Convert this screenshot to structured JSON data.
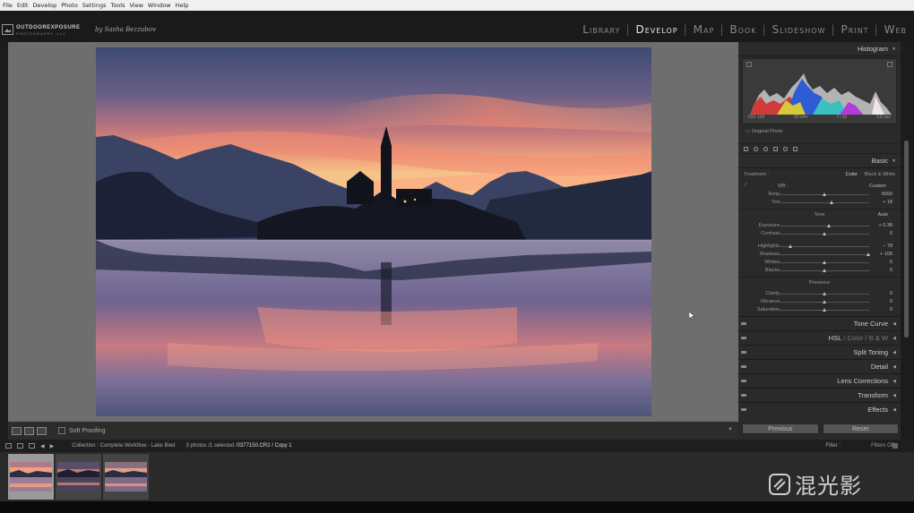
{
  "menu": [
    "File",
    "Edit",
    "Develop",
    "Photo",
    "Settings",
    "Tools",
    "View",
    "Window",
    "Help"
  ],
  "identity": {
    "brand": "OUTDOOREXPOSURE",
    "brand_line2": "PHOTOGRAPHY, LLC",
    "signature": "by Sasha Bezzubov"
  },
  "modules": [
    {
      "label": "Library",
      "active": false
    },
    {
      "label": "Develop",
      "active": true
    },
    {
      "label": "Map",
      "active": false
    },
    {
      "label": "Book",
      "active": false
    },
    {
      "label": "Slideshow",
      "active": false
    },
    {
      "label": "Print",
      "active": false
    },
    {
      "label": "Web",
      "active": false
    }
  ],
  "toolbar": {
    "soft_proofing": "Soft Proofing"
  },
  "histogram": {
    "title": "Histogram",
    "iso": "ISO 100",
    "focal": "50 mm",
    "aperture": "f / 10",
    "shutter": "0.8 sec",
    "original_photo": "Original Photo"
  },
  "basic": {
    "title": "Basic",
    "treatment_label": "Treatment :",
    "treatment_color": "Color",
    "treatment_bw": "Black & White",
    "wb_label": "WB :",
    "wb_value": "Custom",
    "tone_label": "Tone",
    "auto_label": "Auto",
    "presence_label": "Presence",
    "wb_sliders": [
      {
        "name": "Temp",
        "value": "6650",
        "pos": 0.5
      },
      {
        "name": "Tint",
        "value": "+ 18",
        "pos": 0.58
      }
    ],
    "tone_sliders": [
      {
        "name": "Exposure",
        "value": "+ 0.38",
        "pos": 0.55
      },
      {
        "name": "Contrast",
        "value": "0",
        "pos": 0.5
      }
    ],
    "tone_sliders_2": [
      {
        "name": "Highlights",
        "value": "− 78",
        "pos": 0.12
      },
      {
        "name": "Shadows",
        "value": "+ 100",
        "pos": 0.99
      },
      {
        "name": "Whites",
        "value": "0",
        "pos": 0.5
      },
      {
        "name": "Blacks",
        "value": "0",
        "pos": 0.5
      }
    ],
    "presence_sliders": [
      {
        "name": "Clarity",
        "value": "0",
        "pos": 0.5
      },
      {
        "name": "Vibrance",
        "value": "0",
        "pos": 0.5
      },
      {
        "name": "Saturation",
        "value": "0",
        "pos": 0.5
      }
    ]
  },
  "panels": {
    "tone_curve": "Tone Curve",
    "hsl": "HSL",
    "hsl_color": "Color",
    "hsl_bw": "B & W",
    "split_toning": "Split Toning",
    "detail": "Detail",
    "lens_corrections": "Lens Corrections",
    "transform": "Transform",
    "effects": "Effects"
  },
  "buttons": {
    "previous": "Previous",
    "reset": "Reset"
  },
  "filmstrip": {
    "collection": "Collection : Complete Workflow - Lake Bled",
    "count": "3 photos /1 selected /",
    "selected_file": "0377150.CR2 / Copy 1",
    "filter_label": "Filter :",
    "filter_value": "Filters Off"
  },
  "watermark": {
    "text": "混光影"
  },
  "colors": {
    "active_module": "#e8e8e8",
    "canvas": "#6e6e6e",
    "panel": "#2a2a2a"
  }
}
